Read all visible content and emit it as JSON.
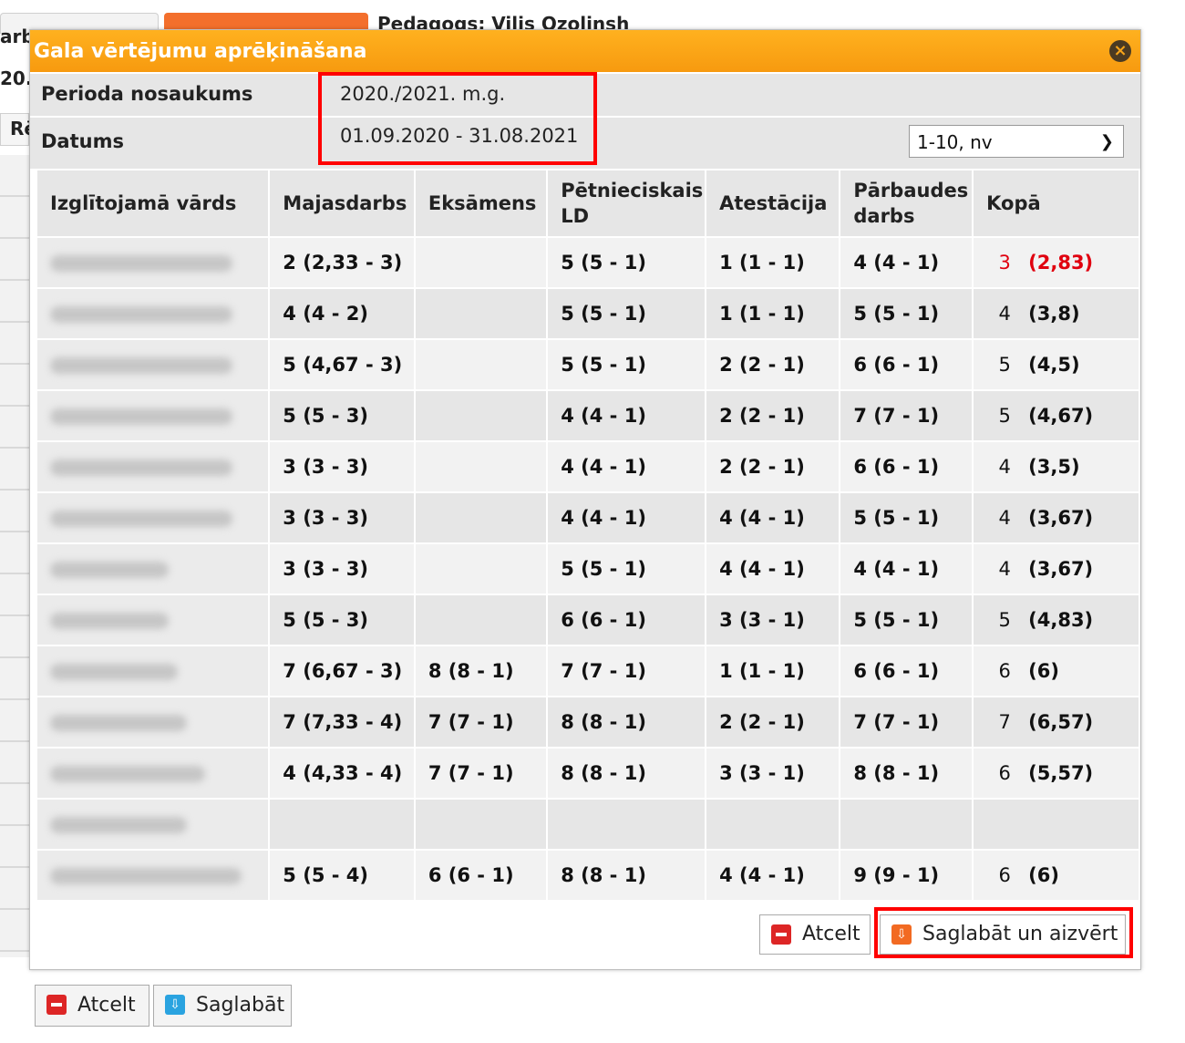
{
  "background": {
    "teacher_text": "Pedagogs: Vilis Ozolinsh",
    "fragment_left_top": "arba",
    "fragment_left_mid": "20.",
    "fragment_btn": "Rē"
  },
  "dialog": {
    "title": "Gala vērtējumu aprēķināšana",
    "close_icon": "×",
    "period_label": "Perioda nosaukums",
    "period_value": "2020./2021. m.g.",
    "date_label": "Datums",
    "date_value": "01.09.2020 - 31.08.2021",
    "scale_select": "1-10, nv",
    "columns": [
      "Izglītojamā vārds",
      "Majasdarbs",
      "Eksāmens",
      "Pētnieciskais LD",
      "Atestācija",
      "Pārbaudes darbs",
      "Kopā"
    ],
    "rows": [
      {
        "maj": "2 (2,33 - 3)",
        "maj_red": true,
        "eks": "",
        "pet": "5 (5 - 1)",
        "ate": "1 (1 - 1)",
        "ate_red": true,
        "par": "4 (4 - 1)",
        "kopa": "3",
        "avg": "(2,83)",
        "kopa_red": true
      },
      {
        "maj": "4 (4 - 2)",
        "maj_red": false,
        "eks": "",
        "pet": "5 (5 - 1)",
        "ate": "1 (1 - 1)",
        "ate_red": true,
        "par": "5 (5 - 1)",
        "kopa": "4",
        "avg": "(3,8)",
        "kopa_red": false
      },
      {
        "maj": "5 (4,67 - 3)",
        "maj_red": false,
        "eks": "",
        "pet": "5 (5 - 1)",
        "ate": "2 (2 - 1)",
        "ate_red": true,
        "par": "6 (6 - 1)",
        "kopa": "5",
        "avg": "(4,5)",
        "kopa_red": false
      },
      {
        "maj": "5 (5 - 3)",
        "maj_red": false,
        "eks": "",
        "pet": "4 (4 - 1)",
        "ate": "2 (2 - 1)",
        "ate_red": true,
        "par": "7 (7 - 1)",
        "kopa": "5",
        "avg": "(4,67)",
        "kopa_red": false
      },
      {
        "maj": "3 (3 - 3)",
        "maj_red": true,
        "eks": "",
        "pet": "4 (4 - 1)",
        "ate": "2 (2 - 1)",
        "ate_red": true,
        "par": "6 (6 - 1)",
        "kopa": "4",
        "avg": "(3,5)",
        "kopa_red": false
      },
      {
        "maj": "3 (3 - 3)",
        "maj_red": true,
        "eks": "",
        "pet": "4 (4 - 1)",
        "ate": "4 (4 - 1)",
        "ate_red": false,
        "par": "5 (5 - 1)",
        "kopa": "4",
        "avg": "(3,67)",
        "kopa_red": false
      },
      {
        "maj": "3 (3 - 3)",
        "maj_red": true,
        "eks": "",
        "pet": "5 (5 - 1)",
        "ate": "4 (4 - 1)",
        "ate_red": false,
        "par": "4 (4 - 1)",
        "kopa": "4",
        "avg": "(3,67)",
        "kopa_red": false
      },
      {
        "maj": "5 (5 - 3)",
        "maj_red": false,
        "eks": "",
        "pet": "6 (6 - 1)",
        "ate": "3 (3 - 1)",
        "ate_red": true,
        "par": "5 (5 - 1)",
        "kopa": "5",
        "avg": "(4,83)",
        "kopa_red": false
      },
      {
        "maj": "7 (6,67 - 3)",
        "maj_red": false,
        "eks": "8 (8 - 1)",
        "pet": "7 (7 - 1)",
        "ate": "1 (1 - 1)",
        "ate_red": true,
        "par": "6 (6 - 1)",
        "kopa": "6",
        "avg": "(6)",
        "kopa_red": false
      },
      {
        "maj": "7 (7,33 - 4)",
        "maj_red": false,
        "eks": "7 (7 - 1)",
        "pet": "8 (8 - 1)",
        "ate": "2 (2 - 1)",
        "ate_red": true,
        "par": "7 (7 - 1)",
        "kopa": "7",
        "avg": "(6,57)",
        "kopa_red": false
      },
      {
        "maj": "4 (4,33 - 4)",
        "maj_red": false,
        "eks": "7 (7 - 1)",
        "pet": "8 (8 - 1)",
        "ate": "3 (3 - 1)",
        "ate_red": true,
        "par": "8 (8 - 1)",
        "kopa": "6",
        "avg": "(5,57)",
        "kopa_red": false
      },
      {
        "maj": "",
        "maj_red": false,
        "eks": "",
        "pet": "",
        "ate": "",
        "ate_red": false,
        "par": "",
        "kopa": "",
        "avg": "",
        "kopa_red": false
      },
      {
        "maj": "5 (5 - 4)",
        "maj_red": false,
        "eks": "6 (6 - 1)",
        "pet": "8 (8 - 1)",
        "ate": "4 (4 - 1)",
        "ate_red": false,
        "par": "9 (9 - 1)",
        "kopa": "6",
        "avg": "(6)",
        "kopa_red": false
      }
    ],
    "cancel_label": "Atcelt",
    "save_close_label": "Saglabāt un aizvērt"
  },
  "page": {
    "cancel_label": "Atcelt",
    "save_label": "Saglabāt"
  },
  "colors": {
    "titlebar": "#f9a316",
    "highlight": "#ff0000",
    "low_grade": "#e0000f"
  }
}
